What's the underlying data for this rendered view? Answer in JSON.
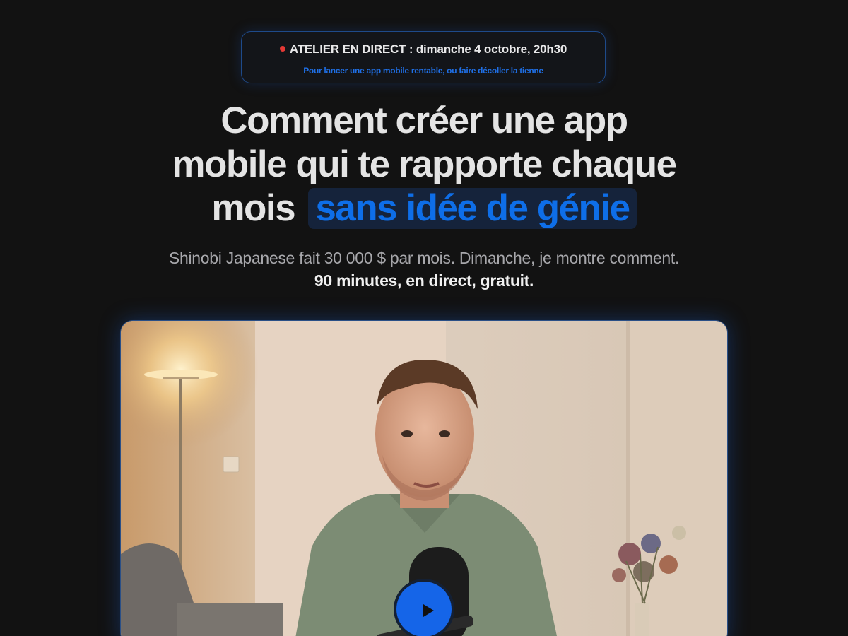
{
  "banner": {
    "title": "ATELIER EN DIRECT : dimanche 4 octobre, 20h30",
    "subtitle": "Pour lancer une app mobile rentable, ou faire décoller la tienne",
    "live_dot_color": "#e53935"
  },
  "headline": {
    "line1": "Comment créer une app",
    "line2": "mobile qui te rapporte chaque",
    "line3_prefix": "mois",
    "highlight": "sans idée de génie",
    "highlight_color": "#0e6ee8"
  },
  "subheadline": {
    "text": "Shinobi Japanese fait 30 000 $ par mois. Dimanche, je montre comment.",
    "strong": "90 minutes, en direct, gratuit."
  },
  "video": {
    "thumbnail_subject": "man in green polo shirt speaking into microphone in a living room",
    "play_icon": "play-icon",
    "accent": "#1565e8"
  }
}
